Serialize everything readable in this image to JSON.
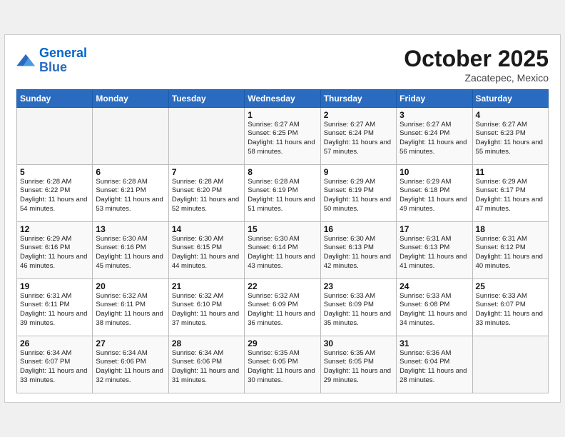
{
  "header": {
    "logo_line1": "General",
    "logo_line2": "Blue",
    "month_title": "October 2025",
    "subtitle": "Zacatepec, Mexico"
  },
  "weekdays": [
    "Sunday",
    "Monday",
    "Tuesday",
    "Wednesday",
    "Thursday",
    "Friday",
    "Saturday"
  ],
  "weeks": [
    [
      {
        "day": "",
        "sunrise": "",
        "sunset": "",
        "daylight": ""
      },
      {
        "day": "",
        "sunrise": "",
        "sunset": "",
        "daylight": ""
      },
      {
        "day": "",
        "sunrise": "",
        "sunset": "",
        "daylight": ""
      },
      {
        "day": "1",
        "sunrise": "Sunrise: 6:27 AM",
        "sunset": "Sunset: 6:25 PM",
        "daylight": "Daylight: 11 hours and 58 minutes."
      },
      {
        "day": "2",
        "sunrise": "Sunrise: 6:27 AM",
        "sunset": "Sunset: 6:24 PM",
        "daylight": "Daylight: 11 hours and 57 minutes."
      },
      {
        "day": "3",
        "sunrise": "Sunrise: 6:27 AM",
        "sunset": "Sunset: 6:24 PM",
        "daylight": "Daylight: 11 hours and 56 minutes."
      },
      {
        "day": "4",
        "sunrise": "Sunrise: 6:27 AM",
        "sunset": "Sunset: 6:23 PM",
        "daylight": "Daylight: 11 hours and 55 minutes."
      }
    ],
    [
      {
        "day": "5",
        "sunrise": "Sunrise: 6:28 AM",
        "sunset": "Sunset: 6:22 PM",
        "daylight": "Daylight: 11 hours and 54 minutes."
      },
      {
        "day": "6",
        "sunrise": "Sunrise: 6:28 AM",
        "sunset": "Sunset: 6:21 PM",
        "daylight": "Daylight: 11 hours and 53 minutes."
      },
      {
        "day": "7",
        "sunrise": "Sunrise: 6:28 AM",
        "sunset": "Sunset: 6:20 PM",
        "daylight": "Daylight: 11 hours and 52 minutes."
      },
      {
        "day": "8",
        "sunrise": "Sunrise: 6:28 AM",
        "sunset": "Sunset: 6:19 PM",
        "daylight": "Daylight: 11 hours and 51 minutes."
      },
      {
        "day": "9",
        "sunrise": "Sunrise: 6:29 AM",
        "sunset": "Sunset: 6:19 PM",
        "daylight": "Daylight: 11 hours and 50 minutes."
      },
      {
        "day": "10",
        "sunrise": "Sunrise: 6:29 AM",
        "sunset": "Sunset: 6:18 PM",
        "daylight": "Daylight: 11 hours and 49 minutes."
      },
      {
        "day": "11",
        "sunrise": "Sunrise: 6:29 AM",
        "sunset": "Sunset: 6:17 PM",
        "daylight": "Daylight: 11 hours and 47 minutes."
      }
    ],
    [
      {
        "day": "12",
        "sunrise": "Sunrise: 6:29 AM",
        "sunset": "Sunset: 6:16 PM",
        "daylight": "Daylight: 11 hours and 46 minutes."
      },
      {
        "day": "13",
        "sunrise": "Sunrise: 6:30 AM",
        "sunset": "Sunset: 6:16 PM",
        "daylight": "Daylight: 11 hours and 45 minutes."
      },
      {
        "day": "14",
        "sunrise": "Sunrise: 6:30 AM",
        "sunset": "Sunset: 6:15 PM",
        "daylight": "Daylight: 11 hours and 44 minutes."
      },
      {
        "day": "15",
        "sunrise": "Sunrise: 6:30 AM",
        "sunset": "Sunset: 6:14 PM",
        "daylight": "Daylight: 11 hours and 43 minutes."
      },
      {
        "day": "16",
        "sunrise": "Sunrise: 6:30 AM",
        "sunset": "Sunset: 6:13 PM",
        "daylight": "Daylight: 11 hours and 42 minutes."
      },
      {
        "day": "17",
        "sunrise": "Sunrise: 6:31 AM",
        "sunset": "Sunset: 6:13 PM",
        "daylight": "Daylight: 11 hours and 41 minutes."
      },
      {
        "day": "18",
        "sunrise": "Sunrise: 6:31 AM",
        "sunset": "Sunset: 6:12 PM",
        "daylight": "Daylight: 11 hours and 40 minutes."
      }
    ],
    [
      {
        "day": "19",
        "sunrise": "Sunrise: 6:31 AM",
        "sunset": "Sunset: 6:11 PM",
        "daylight": "Daylight: 11 hours and 39 minutes."
      },
      {
        "day": "20",
        "sunrise": "Sunrise: 6:32 AM",
        "sunset": "Sunset: 6:11 PM",
        "daylight": "Daylight: 11 hours and 38 minutes."
      },
      {
        "day": "21",
        "sunrise": "Sunrise: 6:32 AM",
        "sunset": "Sunset: 6:10 PM",
        "daylight": "Daylight: 11 hours and 37 minutes."
      },
      {
        "day": "22",
        "sunrise": "Sunrise: 6:32 AM",
        "sunset": "Sunset: 6:09 PM",
        "daylight": "Daylight: 11 hours and 36 minutes."
      },
      {
        "day": "23",
        "sunrise": "Sunrise: 6:33 AM",
        "sunset": "Sunset: 6:09 PM",
        "daylight": "Daylight: 11 hours and 35 minutes."
      },
      {
        "day": "24",
        "sunrise": "Sunrise: 6:33 AM",
        "sunset": "Sunset: 6:08 PM",
        "daylight": "Daylight: 11 hours and 34 minutes."
      },
      {
        "day": "25",
        "sunrise": "Sunrise: 6:33 AM",
        "sunset": "Sunset: 6:07 PM",
        "daylight": "Daylight: 11 hours and 33 minutes."
      }
    ],
    [
      {
        "day": "26",
        "sunrise": "Sunrise: 6:34 AM",
        "sunset": "Sunset: 6:07 PM",
        "daylight": "Daylight: 11 hours and 33 minutes."
      },
      {
        "day": "27",
        "sunrise": "Sunrise: 6:34 AM",
        "sunset": "Sunset: 6:06 PM",
        "daylight": "Daylight: 11 hours and 32 minutes."
      },
      {
        "day": "28",
        "sunrise": "Sunrise: 6:34 AM",
        "sunset": "Sunset: 6:06 PM",
        "daylight": "Daylight: 11 hours and 31 minutes."
      },
      {
        "day": "29",
        "sunrise": "Sunrise: 6:35 AM",
        "sunset": "Sunset: 6:05 PM",
        "daylight": "Daylight: 11 hours and 30 minutes."
      },
      {
        "day": "30",
        "sunrise": "Sunrise: 6:35 AM",
        "sunset": "Sunset: 6:05 PM",
        "daylight": "Daylight: 11 hours and 29 minutes."
      },
      {
        "day": "31",
        "sunrise": "Sunrise: 6:36 AM",
        "sunset": "Sunset: 6:04 PM",
        "daylight": "Daylight: 11 hours and 28 minutes."
      },
      {
        "day": "",
        "sunrise": "",
        "sunset": "",
        "daylight": ""
      }
    ]
  ]
}
